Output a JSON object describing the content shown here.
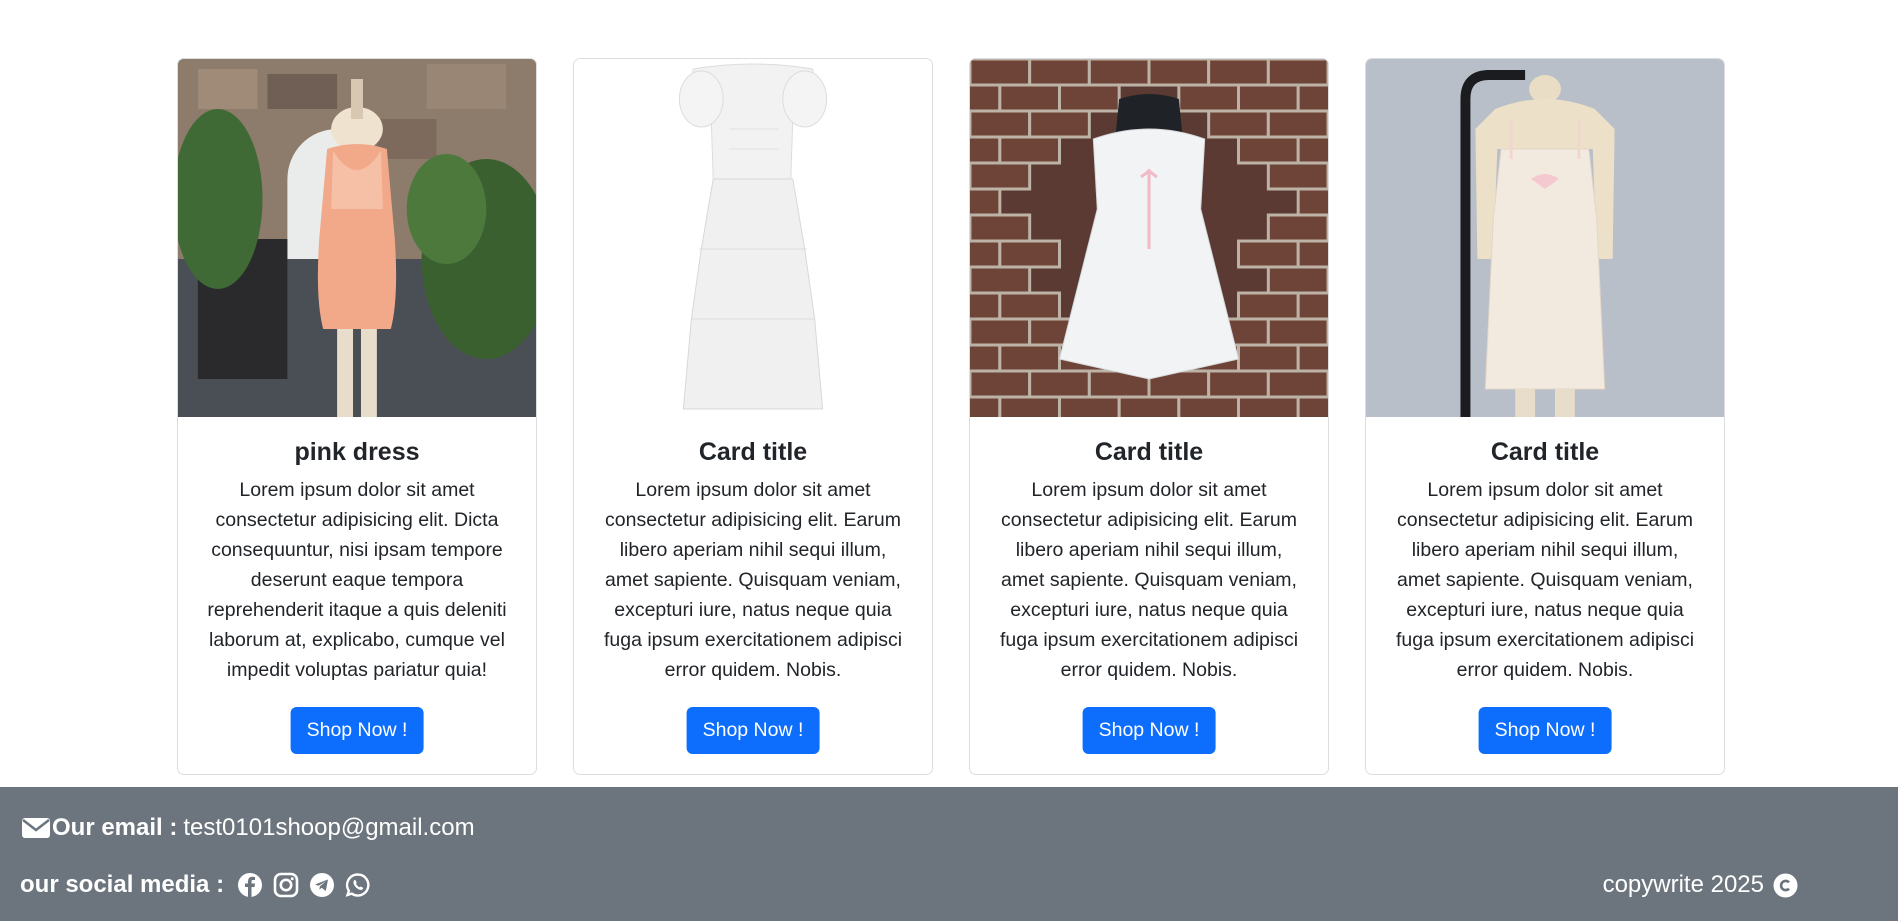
{
  "cards": [
    {
      "title": "pink dress",
      "text": "Lorem ipsum dolor sit amet consectetur adipisicing elit. Dicta consequuntur, nisi ipsam tempore deserunt eaque tempora reprehenderit itaque a quis deleniti laborum at, explicabo, cumque vel impedit voluptas pariatur quia!",
      "button": "Shop Now !",
      "image": "peach-silk-romper-on-mannequin"
    },
    {
      "title": "Card title",
      "text": "Lorem ipsum dolor sit amet consectetur adipisicing elit. Earum libero aperiam nihil sequi illum, amet sapiente. Quisquam veniam, excepturi iure, natus neque quia fuga ipsum exercitationem adipisci error quidem. Nobis.",
      "button": "Shop Now !",
      "image": "white-tiered-maxi-dress"
    },
    {
      "title": "Card title",
      "text": "Lorem ipsum dolor sit amet consectetur adipisicing elit. Earum libero aperiam nihil sequi illum, amet sapiente. Quisquam veniam, excepturi iure, natus neque quia fuga ipsum exercitationem adipisci error quidem. Nobis.",
      "button": "Shop Now !",
      "image": "white-romper-on-brick-wall"
    },
    {
      "title": "Card title",
      "text": "Lorem ipsum dolor sit amet consectetur adipisicing elit. Earum libero aperiam nihil sequi illum, amet sapiente. Quisquam veniam, excepturi iure, natus neque quia fuga ipsum exercitationem adipisci error quidem. Nobis.",
      "button": "Shop Now !",
      "image": "cream-slip-dress-on-mannequin"
    }
  ],
  "footer": {
    "email_label": "Our email :",
    "email_value": "test0101shoop@gmail.com",
    "email_icon": "envelope-icon",
    "social_label": "our social media :",
    "social_icons": [
      "facebook-icon",
      "instagram-icon",
      "telegram-icon",
      "whatsapp-icon"
    ],
    "copyright_text": "copywrite 2025",
    "copyright_icon": "copyright-icon"
  },
  "colors": {
    "button_bg": "#0d6efd",
    "footer_bg": "#6c757d",
    "text": "#212529"
  }
}
